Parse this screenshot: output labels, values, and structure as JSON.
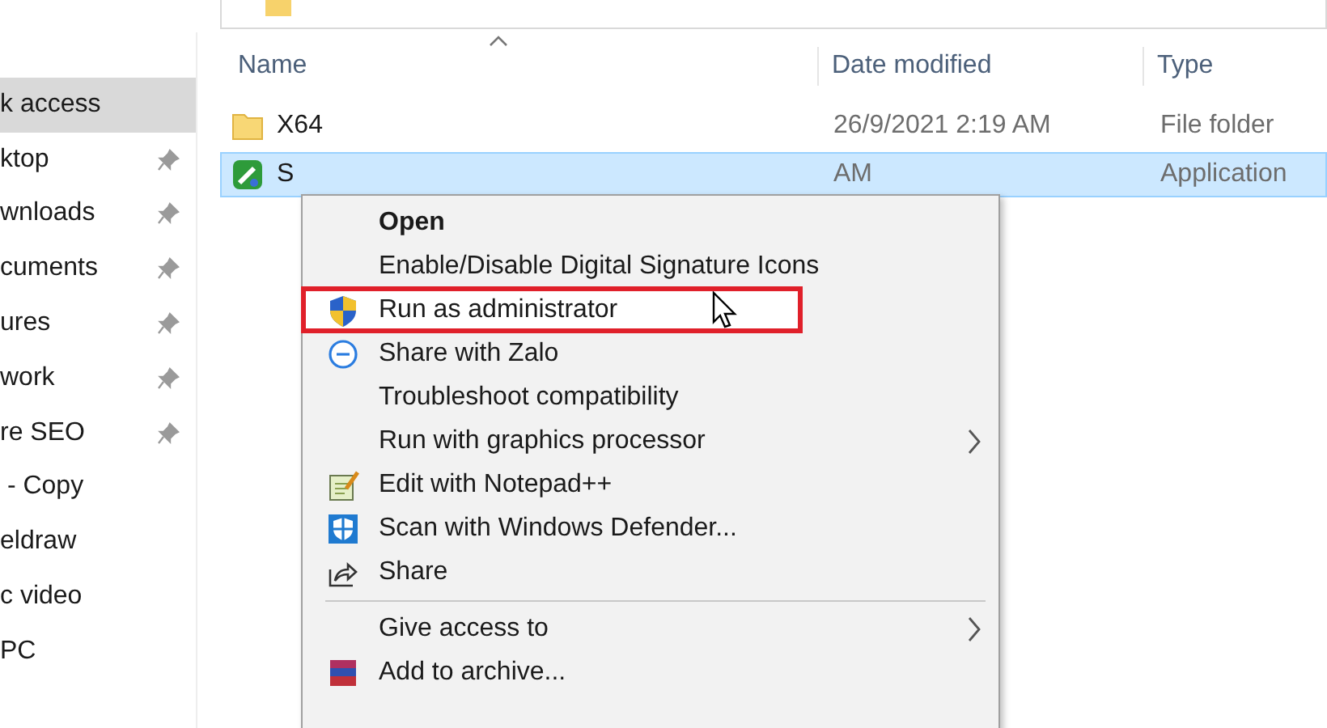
{
  "sidebar": {
    "items": [
      {
        "label": "k access",
        "selected": true,
        "pinned": false
      },
      {
        "label": "ktop",
        "selected": false,
        "pinned": true
      },
      {
        "label": "wnloads",
        "selected": false,
        "pinned": true
      },
      {
        "label": "cuments",
        "selected": false,
        "pinned": true
      },
      {
        "label": "ures",
        "selected": false,
        "pinned": true
      },
      {
        "label": "work",
        "selected": false,
        "pinned": true
      },
      {
        "label": "re SEO",
        "selected": false,
        "pinned": true
      },
      {
        "label": " - Copy",
        "selected": false,
        "pinned": false
      },
      {
        "label": "eldraw",
        "selected": false,
        "pinned": false
      },
      {
        "label": "c video",
        "selected": false,
        "pinned": false
      },
      {
        "label": "PC",
        "selected": false,
        "pinned": false
      }
    ]
  },
  "file_list": {
    "columns": [
      "Name",
      "Date modified",
      "Type"
    ],
    "rows": [
      {
        "kind": "folder",
        "name": "X64",
        "date": "26/9/2021 2:19 AM",
        "type": "File folder",
        "selected": false
      },
      {
        "kind": "app",
        "name": "S",
        "date": "AM",
        "type": "Application",
        "selected": true
      }
    ]
  },
  "context_menu": {
    "items": [
      {
        "kind": "default",
        "label": "Open",
        "highlighted": false
      },
      {
        "kind": "plain",
        "label": "Enable/Disable Digital Signature Icons",
        "highlighted": false
      },
      {
        "kind": "shield",
        "label": "Run as administrator",
        "highlighted": true
      },
      {
        "kind": "zalo",
        "label": "Share with Zalo",
        "highlighted": false
      },
      {
        "kind": "plain",
        "label": "Troubleshoot compatibility",
        "highlighted": false
      },
      {
        "kind": "submenu",
        "label": "Run with graphics processor",
        "highlighted": false
      },
      {
        "kind": "notepad",
        "label": "Edit with Notepad++",
        "highlighted": false
      },
      {
        "kind": "defender",
        "label": "Scan with Windows Defender...",
        "highlighted": false
      },
      {
        "kind": "share",
        "label": "Share",
        "highlighted": false
      },
      {
        "kind": "separator"
      },
      {
        "kind": "submenu",
        "label": "Give access to",
        "highlighted": false
      },
      {
        "kind": "archive",
        "label": "Add to archive...",
        "highlighted": false
      }
    ]
  }
}
